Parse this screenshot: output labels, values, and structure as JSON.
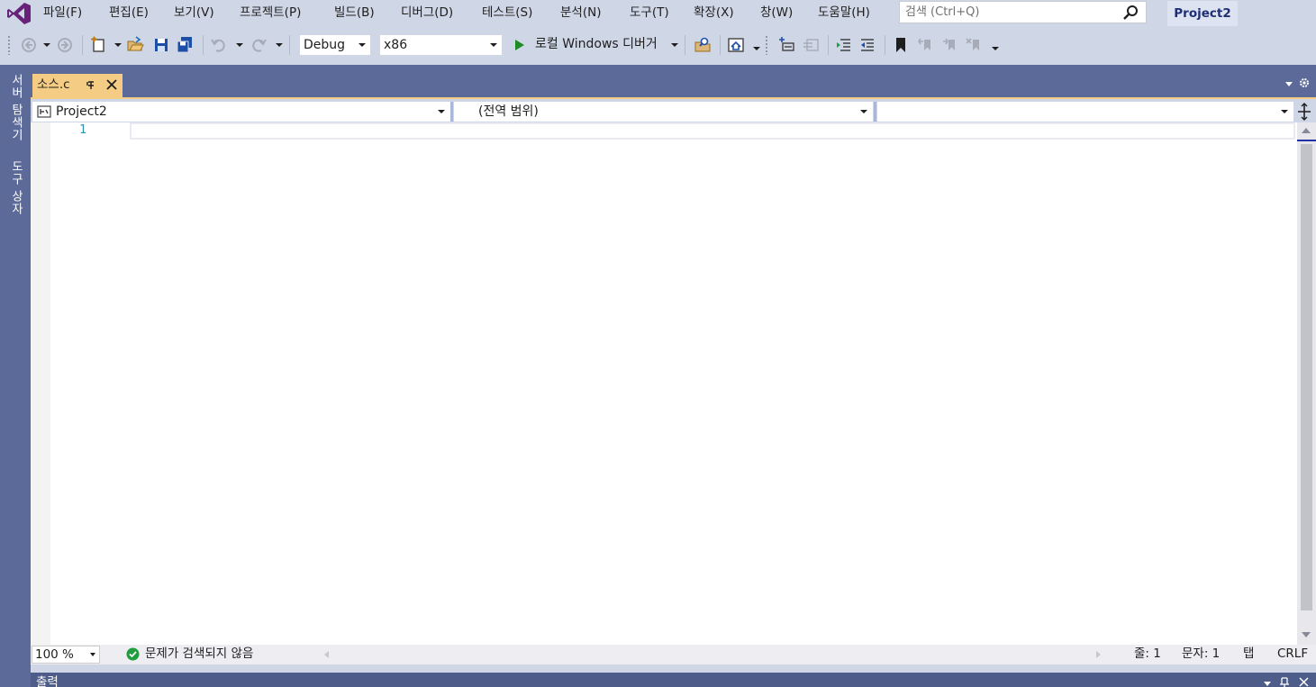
{
  "menu": {
    "items": [
      {
        "label": "파일(F)"
      },
      {
        "label": "편집(E)"
      },
      {
        "label": "보기(V)"
      },
      {
        "label": "프로젝트(P)"
      },
      {
        "label": "빌드(B)"
      },
      {
        "label": "디버그(D)"
      },
      {
        "label": "테스트(S)"
      },
      {
        "label": "분석(N)"
      },
      {
        "label": "도구(T)"
      },
      {
        "label": "확장(X)"
      },
      {
        "label": "창(W)"
      },
      {
        "label": "도움말(H)"
      }
    ],
    "search_placeholder": "검색 (Ctrl+Q)",
    "project_name": "Project2"
  },
  "toolbar": {
    "configuration": "Debug",
    "platform": "x86",
    "start_debug_label": "로컬 Windows 디버거"
  },
  "left_rail": {
    "tabs": [
      "서버 탐색기",
      "도구 상자"
    ]
  },
  "document": {
    "tab_label": "소스.c"
  },
  "navbar": {
    "project": "Project2",
    "scope": "(전역 범위)",
    "member": ""
  },
  "editor": {
    "line_numbers": [
      "1"
    ]
  },
  "status": {
    "zoom": "100 %",
    "issues": "문제가 검색되지 않음",
    "line": "줄: 1",
    "char": "문자: 1",
    "indent": "탭",
    "line_ending": "CRLF"
  },
  "output_panel": {
    "title": "출력"
  },
  "colors": {
    "ide_background": "#cfd6e5",
    "rail": "#5b6a99",
    "active_tab": "#f5cc84",
    "brand_purple": "#68217a",
    "line_number": "#2b91af",
    "start_green": "#1f8b24",
    "success_green": "#1e9e3d"
  },
  "icons": [
    "visual-studio-logo",
    "search-icon",
    "back-icon",
    "forward-icon",
    "new-project-icon",
    "open-icon",
    "save-icon",
    "save-all-icon",
    "undo-icon",
    "redo-icon",
    "play-icon",
    "find-icon",
    "solution-explorer-icon",
    "comment-icon",
    "uncomment-icon",
    "indent-icon",
    "outdent-icon",
    "bookmark-icon",
    "pin-icon",
    "close-icon",
    "gear-icon",
    "split-icon",
    "check-circle-icon"
  ]
}
